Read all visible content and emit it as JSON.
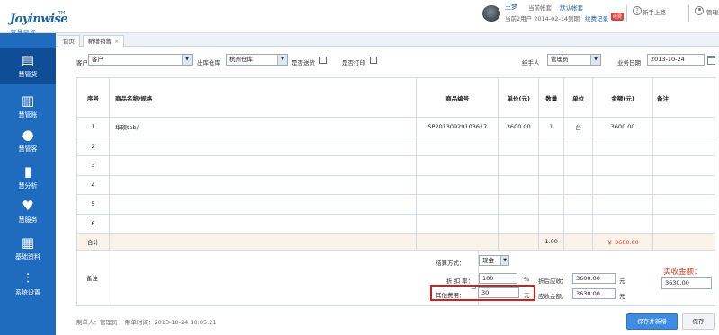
{
  "logo": {
    "name": "Joyinwise",
    "sub": "智慧商贸",
    "tm": "TM"
  },
  "user": {
    "name": "王梦",
    "account_label": "当前帐套：",
    "account_value": "默认帐套",
    "expire_text": "当前2用户 2014-02-14到期",
    "recharge": "续费记录",
    "renew_badge": "续费",
    "novice": "新手上路",
    "admin": "管理员"
  },
  "sidebar": [
    {
      "label": "慧管货",
      "icon": "store-icon"
    },
    {
      "label": "慧管账",
      "icon": "ledger-icon"
    },
    {
      "label": "慧管客",
      "icon": "customers-icon"
    },
    {
      "label": "慧分析",
      "icon": "chart-icon"
    },
    {
      "label": "慧服务",
      "icon": "heart-icon"
    },
    {
      "label": "基础资料",
      "icon": "book-icon"
    },
    {
      "label": "系统设置",
      "icon": "settings-icon"
    }
  ],
  "tabs": [
    {
      "label": "首页"
    },
    {
      "label": "新增销售"
    }
  ],
  "filters": {
    "customer_label": "客户",
    "customer_value": "客户",
    "warehouse_label": "出库仓库",
    "warehouse_value": "杭州仓库",
    "delivery_label": "是否送货",
    "print_label": "是否打印",
    "handler_label": "经手人",
    "handler_value": "管理员",
    "date_label": "业务日期",
    "date_value": "2013-10-24"
  },
  "table": {
    "headers": [
      "序号",
      "商品名称/规格",
      "商品编号",
      "单价(元)",
      "数量",
      "单位",
      "金额(元)",
      "备注"
    ],
    "rows": [
      {
        "no": "1",
        "name": "华硕tab/",
        "code": "SP20130929103617",
        "price": "3600.00",
        "qty": "1",
        "unit": "台",
        "amount": "3600.00",
        "note": ""
      },
      {
        "no": "2",
        "name": "",
        "code": "",
        "price": "",
        "qty": "",
        "unit": "",
        "amount": "",
        "note": ""
      },
      {
        "no": "3",
        "name": "",
        "code": "",
        "price": "",
        "qty": "",
        "unit": "",
        "amount": "",
        "note": ""
      },
      {
        "no": "4",
        "name": "",
        "code": "",
        "price": "",
        "qty": "",
        "unit": "",
        "amount": "",
        "note": ""
      },
      {
        "no": "5",
        "name": "",
        "code": "",
        "price": "",
        "qty": "",
        "unit": "",
        "amount": "",
        "note": ""
      },
      {
        "no": "6",
        "name": "",
        "code": "",
        "price": "",
        "qty": "",
        "unit": "",
        "amount": "",
        "note": ""
      }
    ],
    "total_label": "合计",
    "total_qty": "1.00",
    "total_amount": "￥ 3600.00"
  },
  "settlement": {
    "note_label": "备注",
    "method_label": "结算方式：",
    "method_value": "现金",
    "discount_label": "折 扣 率：",
    "discount_value": "100",
    "discount_unit": "%",
    "due_label": "折后应收：",
    "due_value": "3600.00",
    "due_unit": "元",
    "other_label": "其他费用：",
    "other_value": "30",
    "other_unit": "元",
    "receivable_label": "应收金额：",
    "receivable_value": "3630.00",
    "receivable_unit": "元",
    "received_label": "实收金额：",
    "received_value": "3630.00"
  },
  "footer": {
    "creator": "制单人：管理员",
    "created_time": "制单时间：2013-10-24 10:05:21",
    "save_new": "保存并新增",
    "save": "保存"
  },
  "colors": {
    "sidebar": "#1f6cbf",
    "primary_button": "#3e8de2",
    "highlight": "#d21e1e",
    "amount_red": "#d23b2f"
  }
}
